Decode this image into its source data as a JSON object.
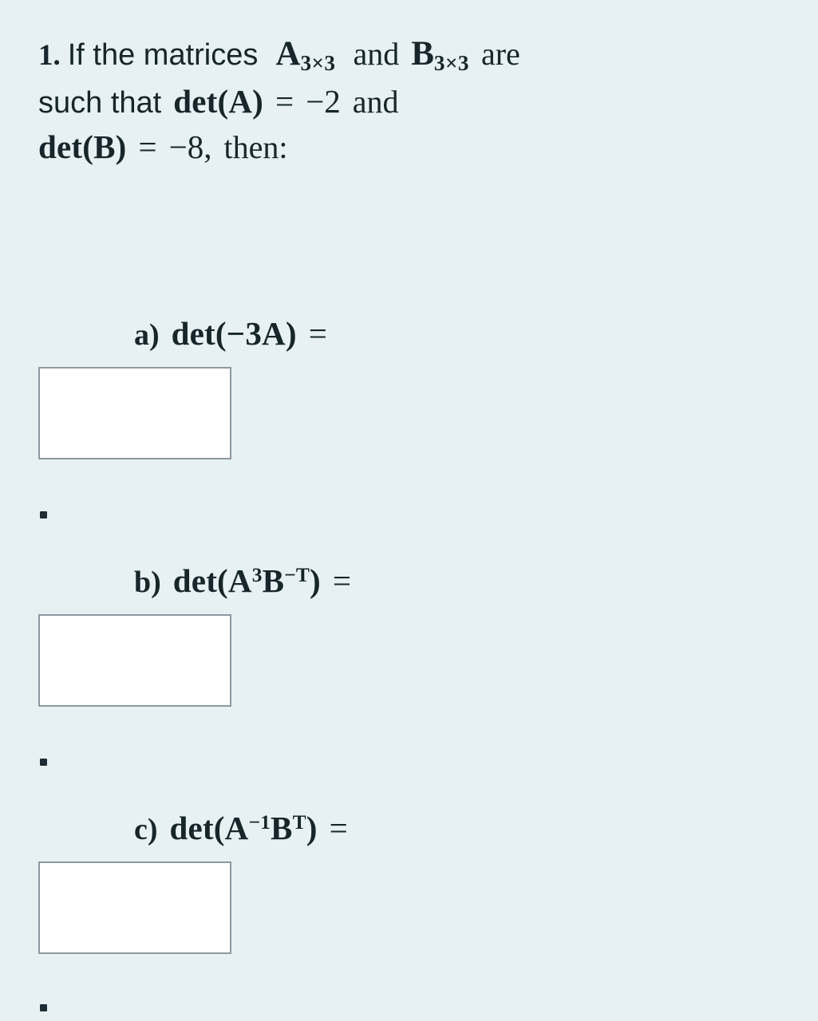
{
  "document": {
    "background_color": "#e7f0f2",
    "text_color": "#16262b",
    "box_border_color": "#8d98a2",
    "box_fill_color": "#ffffff"
  },
  "question": {
    "number": "1.",
    "line1": {
      "text_a": "If the matrices",
      "matrix_a": "A",
      "matrix_a_sub": "3×3",
      "text_b": "and",
      "matrix_b": "B",
      "matrix_b_sub": "3×3",
      "text_c": "are"
    },
    "line2": {
      "text_a": "such that",
      "expr": "det(A)",
      "equals": "=",
      "value": "−2",
      "text_b": "and"
    },
    "line3": {
      "expr": "det(B)",
      "equals": "=",
      "value": "−8,",
      "text_b": "then:"
    },
    "full_text": "1. If the matrices A3×3 and B3×3 are such that det(A) = −2 and det(B) = −8, then:"
  },
  "parts": [
    {
      "letter": "a)",
      "expr_prefix": "det(",
      "expr_base1": "−3A",
      "expr_suffix": ")",
      "equals": "=",
      "expr_plain": "det(−3A) =",
      "answer_value": "",
      "answer_placeholder": ""
    },
    {
      "letter": "b)",
      "expr_prefix": "det(",
      "base1": "A",
      "sup1": "3",
      "base2": "B",
      "sup2": "−T",
      "expr_suffix": ")",
      "equals": "=",
      "expr_plain": "det(A³B⁻ᵀ) =",
      "answer_value": "",
      "answer_placeholder": ""
    },
    {
      "letter": "c)",
      "expr_prefix": "det(",
      "base1": "A",
      "sup1": "−1",
      "base2": "B",
      "sup2": "T",
      "expr_suffix": ")",
      "equals": "=",
      "expr_plain": "det(A⁻¹Bᵀ) =",
      "answer_value": "",
      "answer_placeholder": ""
    }
  ]
}
